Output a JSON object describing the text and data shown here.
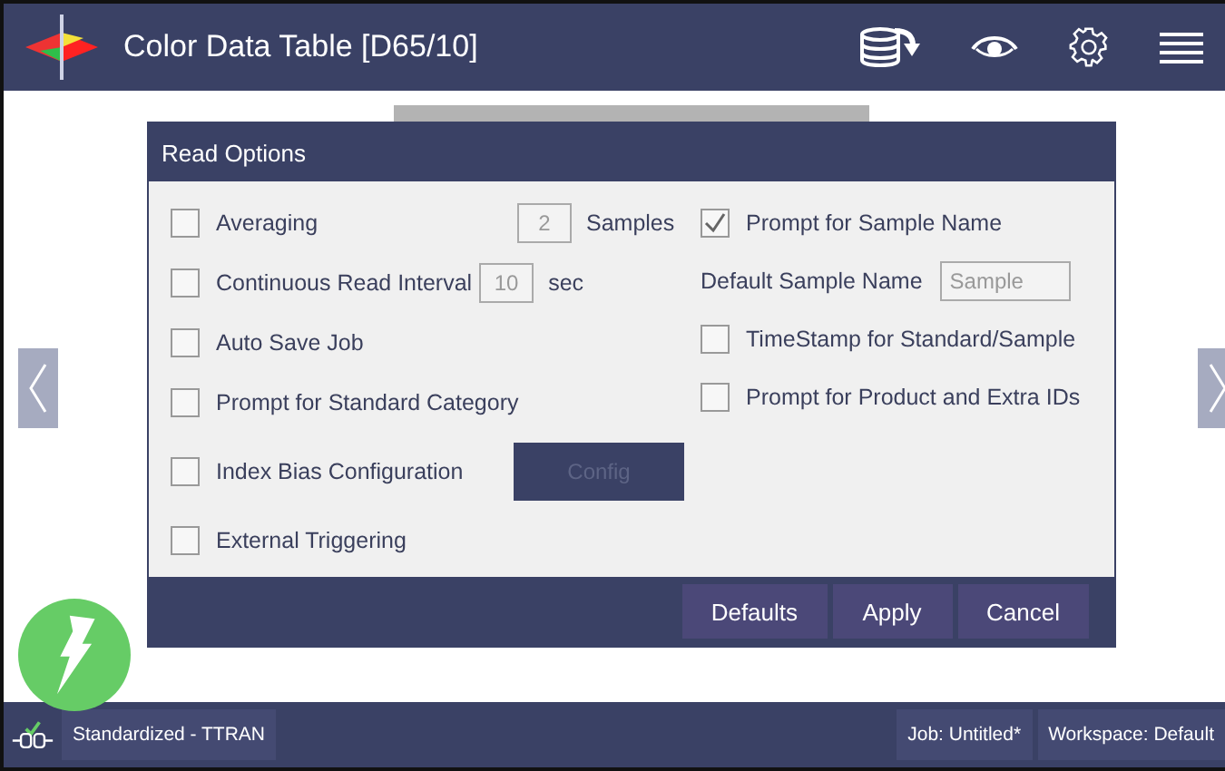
{
  "header": {
    "title": "Color Data Table [D65/10]"
  },
  "dialog": {
    "title": "Read Options",
    "left_options": [
      {
        "kind": "field",
        "label": "Averaging",
        "checked": false,
        "field": {
          "value": "2",
          "disabled": true
        },
        "unit": "Samples"
      },
      {
        "kind": "field",
        "label": "Continuous Read Interval",
        "checked": false,
        "field": {
          "value": "10",
          "disabled": true
        },
        "unit": "sec"
      },
      {
        "kind": "checkbox",
        "label": "Auto Save Job",
        "checked": false
      },
      {
        "kind": "checkbox",
        "label": "Prompt for Standard Category",
        "checked": false
      },
      {
        "kind": "button",
        "label": "Index Bias Configuration",
        "checked": false,
        "button": {
          "label": "Config",
          "disabled": true
        }
      },
      {
        "kind": "checkbox",
        "label": "External Triggering",
        "checked": false
      }
    ],
    "right_options": [
      {
        "kind": "checkbox",
        "label": "Prompt for Sample Name",
        "checked": true
      },
      {
        "kind": "text",
        "label": "Default Sample Name",
        "placeholder": "Sample"
      },
      {
        "kind": "checkbox",
        "label": "TimeStamp for Standard/Sample",
        "checked": false
      },
      {
        "kind": "checkbox",
        "label": "Prompt for Product and Extra IDs",
        "checked": false
      }
    ],
    "buttons": [
      "Defaults",
      "Apply",
      "Cancel"
    ]
  },
  "status_bar": {
    "connection": "Standardized - TTRAN",
    "job": "Job: Untitled*",
    "workspace": "Workspace: Default"
  }
}
